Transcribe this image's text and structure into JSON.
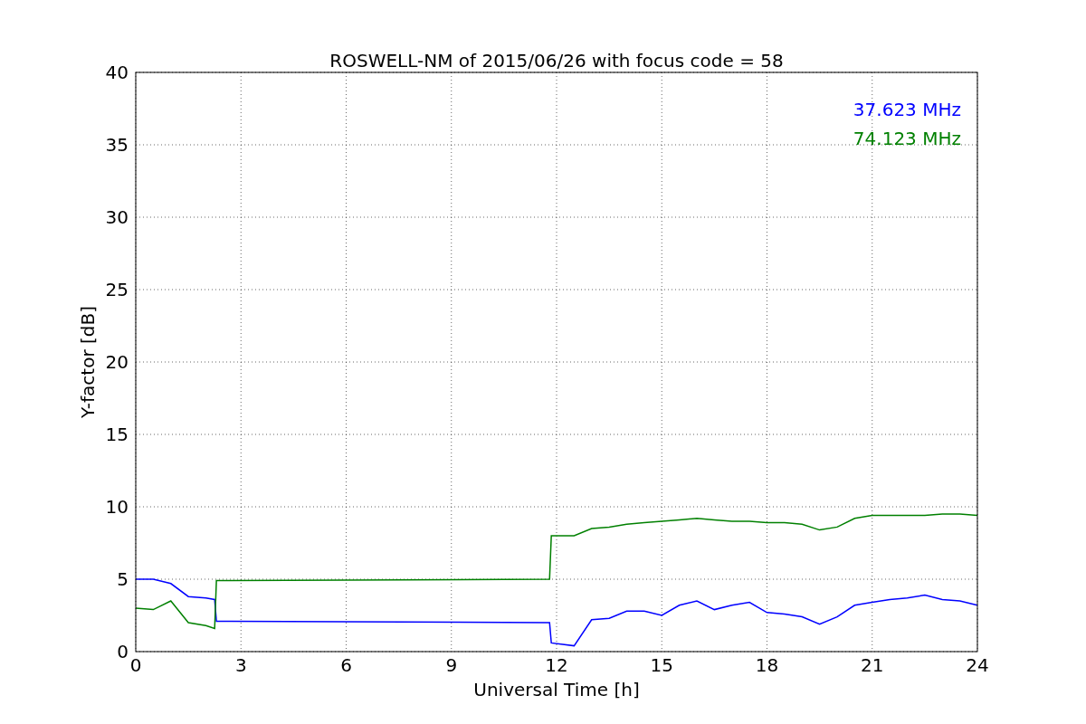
{
  "chart_data": {
    "type": "line",
    "title": "ROSWELL-NM of 2015/06/26 with focus code = 58",
    "xlabel": "Universal Time [h]",
    "ylabel": "Y-factor [dB]",
    "x": [
      0,
      0.5,
      1,
      1.5,
      2,
      2.25,
      2.3,
      11.8,
      11.85,
      12.5,
      13,
      13.5,
      14,
      14.5,
      15,
      15.5,
      16,
      16.5,
      17,
      17.5,
      18,
      18.5,
      19,
      19.5,
      20,
      20.5,
      21,
      21.5,
      22,
      22.5,
      23,
      23.5,
      24
    ],
    "series": [
      {
        "name": "37.623 MHz",
        "color": "#0000ff",
        "values": [
          5,
          5,
          4.7,
          3.8,
          3.7,
          3.6,
          2.1,
          2.0,
          0.6,
          0.4,
          2.2,
          2.3,
          2.8,
          2.8,
          2.5,
          3.2,
          3.5,
          2.9,
          3.2,
          3.4,
          2.7,
          2.6,
          2.4,
          1.9,
          2.4,
          3.2,
          3.4,
          3.6,
          3.7,
          3.9,
          3.6,
          3.5,
          3.2
        ]
      },
      {
        "name": "74.123 MHz",
        "color": "#008000",
        "values": [
          3,
          2.9,
          3.5,
          2.0,
          1.8,
          1.6,
          4.9,
          5.0,
          8.0,
          8.0,
          8.5,
          8.6,
          8.8,
          8.9,
          9.0,
          9.1,
          9.2,
          9.1,
          9.0,
          9.0,
          8.9,
          8.9,
          8.8,
          8.4,
          8.6,
          9.2,
          9.4,
          9.4,
          9.4,
          9.4,
          9.5,
          9.5,
          9.4
        ]
      }
    ],
    "grid": true,
    "xlim": [
      0,
      24
    ],
    "ylim": [
      0,
      40
    ],
    "xticks": [
      0,
      3,
      6,
      9,
      12,
      15,
      18,
      21,
      24
    ],
    "yticks": [
      0,
      5,
      10,
      15,
      20,
      25,
      30,
      35,
      40
    ]
  }
}
